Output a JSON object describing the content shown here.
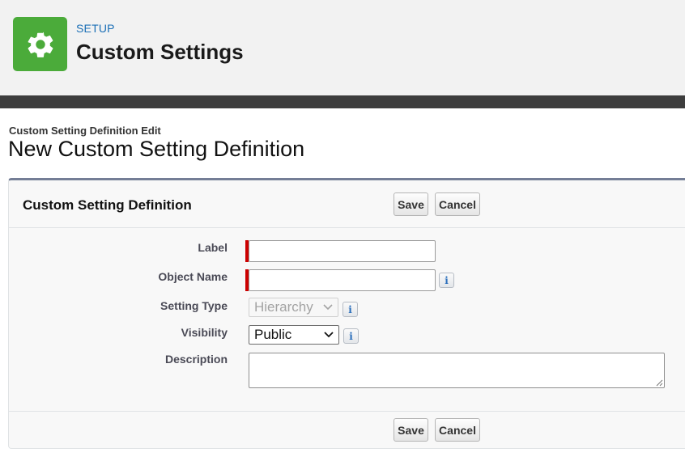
{
  "header": {
    "kicker": "SETUP",
    "title": "Custom Settings",
    "icon": "gear-icon",
    "icon_color": "#4bab3a"
  },
  "page": {
    "subtitle": "Custom Setting Definition Edit",
    "title": "New Custom Setting Definition"
  },
  "panel": {
    "title": "Custom Setting Definition",
    "save_label": "Save",
    "cancel_label": "Cancel"
  },
  "form": {
    "label": {
      "label": "Label",
      "value": "",
      "required": true
    },
    "object_name": {
      "label": "Object Name",
      "value": "",
      "required": true,
      "info_icon": "info-icon"
    },
    "setting_type": {
      "label": "Setting Type",
      "value": "Hierarchy",
      "disabled": true,
      "info_icon": "info-icon"
    },
    "visibility": {
      "label": "Visibility",
      "value": "Public",
      "info_icon": "info-icon"
    },
    "description": {
      "label": "Description",
      "value": ""
    }
  },
  "colors": {
    "required_marker": "#cc0000",
    "link_blue": "#1b6fb6",
    "panel_accent": "#747e96"
  }
}
